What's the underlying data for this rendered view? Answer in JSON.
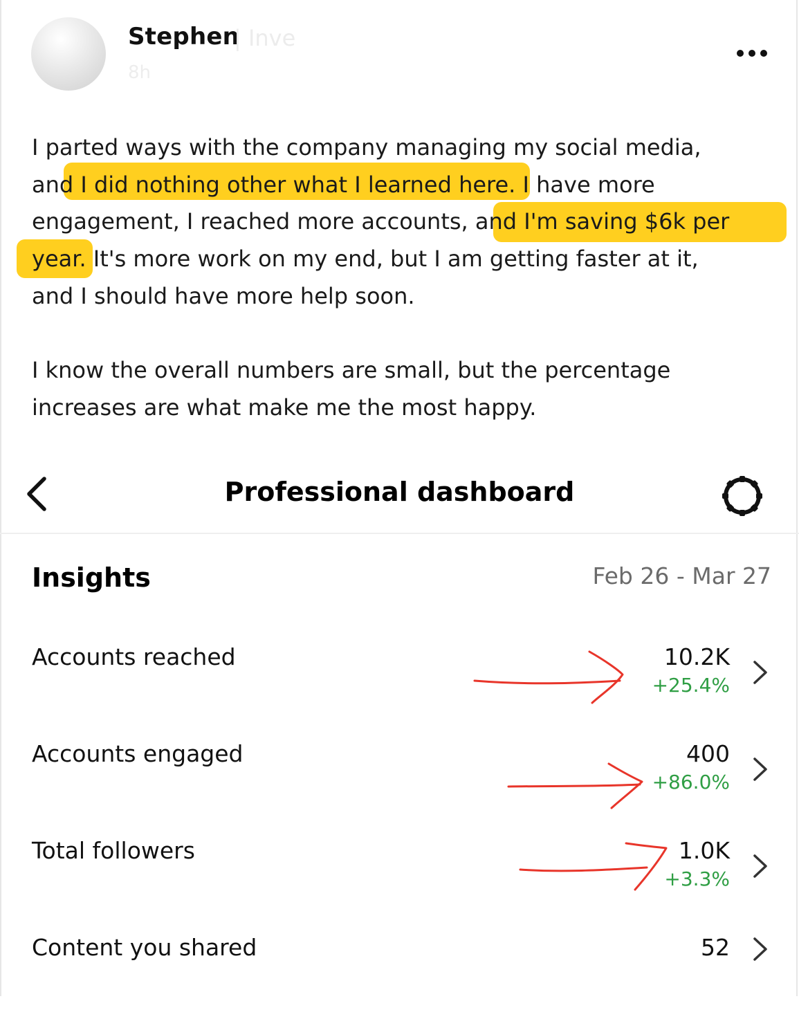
{
  "post": {
    "author": "Stephen",
    "author_suffix": "| Inve",
    "time": "8h",
    "paragraph1": [
      "I parted ways with the company managing my social media,",
      "and I did nothing other what I learned here. I have more",
      "engagement, I reached more accounts, and I'm saving $6k per",
      "year. It's more work on my end, but I am getting faster at it,",
      "and I should have more help soon."
    ],
    "paragraph2": [
      "I know the overall numbers are small, but the percentage",
      "increases are what make me the most happy."
    ],
    "highlight_color": "#ffcf1f",
    "annotation_color": "#e8352a"
  },
  "dashboard": {
    "title": "Professional dashboard",
    "insights_title": "Insights",
    "date_range": "Feb 26 - Mar 27",
    "rows": [
      {
        "label": "Accounts reached",
        "value": "10.2K",
        "change": "+25.4%"
      },
      {
        "label": "Accounts engaged",
        "value": "400",
        "change": "+86.0%"
      },
      {
        "label": "Total followers",
        "value": "1.0K",
        "change": "+3.3%"
      },
      {
        "label": "Content you shared",
        "value": "52"
      }
    ],
    "positive_color": "#2f9e44"
  }
}
